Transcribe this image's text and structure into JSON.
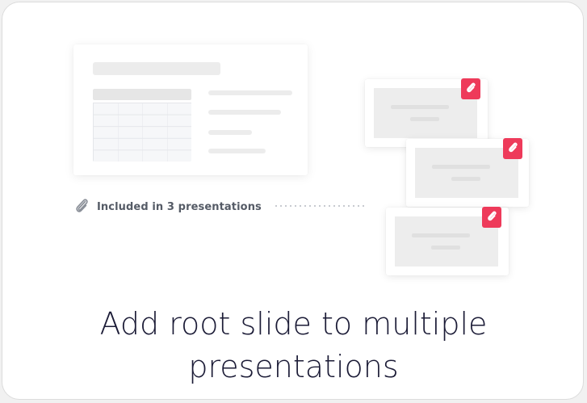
{
  "card": {
    "included_label": "Included in 3 presentations",
    "caption_line1": "Add root slide to multiple",
    "caption_line2": "presentations"
  },
  "icons": {
    "attachment": "paperclip-icon"
  },
  "colors": {
    "badge": "#ee3a5a",
    "caption_text": "#1b1b36",
    "placeholder": "#ececec"
  }
}
